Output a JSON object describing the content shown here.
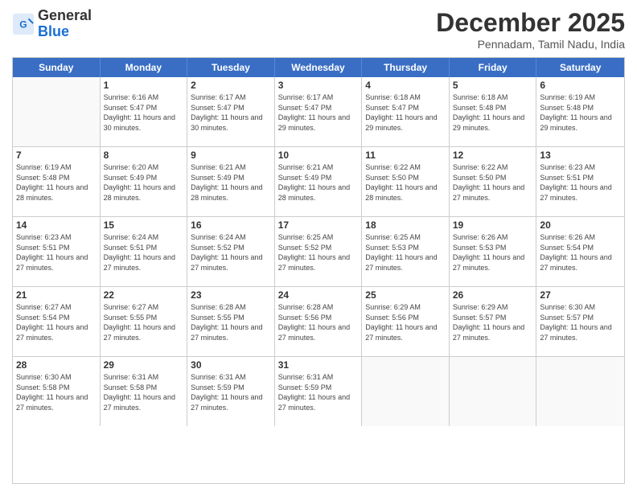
{
  "header": {
    "logo_line1": "General",
    "logo_line2": "Blue",
    "month": "December 2025",
    "location": "Pennadam, Tamil Nadu, India"
  },
  "days": [
    "Sunday",
    "Monday",
    "Tuesday",
    "Wednesday",
    "Thursday",
    "Friday",
    "Saturday"
  ],
  "rows": [
    [
      {
        "date": "",
        "empty": true
      },
      {
        "date": "1",
        "sunrise": "6:16 AM",
        "sunset": "5:47 PM",
        "daylight": "11 hours and 30 minutes."
      },
      {
        "date": "2",
        "sunrise": "6:17 AM",
        "sunset": "5:47 PM",
        "daylight": "11 hours and 30 minutes."
      },
      {
        "date": "3",
        "sunrise": "6:17 AM",
        "sunset": "5:47 PM",
        "daylight": "11 hours and 29 minutes."
      },
      {
        "date": "4",
        "sunrise": "6:18 AM",
        "sunset": "5:47 PM",
        "daylight": "11 hours and 29 minutes."
      },
      {
        "date": "5",
        "sunrise": "6:18 AM",
        "sunset": "5:48 PM",
        "daylight": "11 hours and 29 minutes."
      },
      {
        "date": "6",
        "sunrise": "6:19 AM",
        "sunset": "5:48 PM",
        "daylight": "11 hours and 29 minutes."
      }
    ],
    [
      {
        "date": "7",
        "sunrise": "6:19 AM",
        "sunset": "5:48 PM",
        "daylight": "11 hours and 28 minutes."
      },
      {
        "date": "8",
        "sunrise": "6:20 AM",
        "sunset": "5:49 PM",
        "daylight": "11 hours and 28 minutes."
      },
      {
        "date": "9",
        "sunrise": "6:21 AM",
        "sunset": "5:49 PM",
        "daylight": "11 hours and 28 minutes."
      },
      {
        "date": "10",
        "sunrise": "6:21 AM",
        "sunset": "5:49 PM",
        "daylight": "11 hours and 28 minutes."
      },
      {
        "date": "11",
        "sunrise": "6:22 AM",
        "sunset": "5:50 PM",
        "daylight": "11 hours and 28 minutes."
      },
      {
        "date": "12",
        "sunrise": "6:22 AM",
        "sunset": "5:50 PM",
        "daylight": "11 hours and 27 minutes."
      },
      {
        "date": "13",
        "sunrise": "6:23 AM",
        "sunset": "5:51 PM",
        "daylight": "11 hours and 27 minutes."
      }
    ],
    [
      {
        "date": "14",
        "sunrise": "6:23 AM",
        "sunset": "5:51 PM",
        "daylight": "11 hours and 27 minutes."
      },
      {
        "date": "15",
        "sunrise": "6:24 AM",
        "sunset": "5:51 PM",
        "daylight": "11 hours and 27 minutes."
      },
      {
        "date": "16",
        "sunrise": "6:24 AM",
        "sunset": "5:52 PM",
        "daylight": "11 hours and 27 minutes."
      },
      {
        "date": "17",
        "sunrise": "6:25 AM",
        "sunset": "5:52 PM",
        "daylight": "11 hours and 27 minutes."
      },
      {
        "date": "18",
        "sunrise": "6:25 AM",
        "sunset": "5:53 PM",
        "daylight": "11 hours and 27 minutes."
      },
      {
        "date": "19",
        "sunrise": "6:26 AM",
        "sunset": "5:53 PM",
        "daylight": "11 hours and 27 minutes."
      },
      {
        "date": "20",
        "sunrise": "6:26 AM",
        "sunset": "5:54 PM",
        "daylight": "11 hours and 27 minutes."
      }
    ],
    [
      {
        "date": "21",
        "sunrise": "6:27 AM",
        "sunset": "5:54 PM",
        "daylight": "11 hours and 27 minutes."
      },
      {
        "date": "22",
        "sunrise": "6:27 AM",
        "sunset": "5:55 PM",
        "daylight": "11 hours and 27 minutes."
      },
      {
        "date": "23",
        "sunrise": "6:28 AM",
        "sunset": "5:55 PM",
        "daylight": "11 hours and 27 minutes."
      },
      {
        "date": "24",
        "sunrise": "6:28 AM",
        "sunset": "5:56 PM",
        "daylight": "11 hours and 27 minutes."
      },
      {
        "date": "25",
        "sunrise": "6:29 AM",
        "sunset": "5:56 PM",
        "daylight": "11 hours and 27 minutes."
      },
      {
        "date": "26",
        "sunrise": "6:29 AM",
        "sunset": "5:57 PM",
        "daylight": "11 hours and 27 minutes."
      },
      {
        "date": "27",
        "sunrise": "6:30 AM",
        "sunset": "5:57 PM",
        "daylight": "11 hours and 27 minutes."
      }
    ],
    [
      {
        "date": "28",
        "sunrise": "6:30 AM",
        "sunset": "5:58 PM",
        "daylight": "11 hours and 27 minutes."
      },
      {
        "date": "29",
        "sunrise": "6:31 AM",
        "sunset": "5:58 PM",
        "daylight": "11 hours and 27 minutes."
      },
      {
        "date": "30",
        "sunrise": "6:31 AM",
        "sunset": "5:59 PM",
        "daylight": "11 hours and 27 minutes."
      },
      {
        "date": "31",
        "sunrise": "6:31 AM",
        "sunset": "5:59 PM",
        "daylight": "11 hours and 27 minutes."
      },
      {
        "date": "",
        "empty": true
      },
      {
        "date": "",
        "empty": true
      },
      {
        "date": "",
        "empty": true
      }
    ]
  ]
}
